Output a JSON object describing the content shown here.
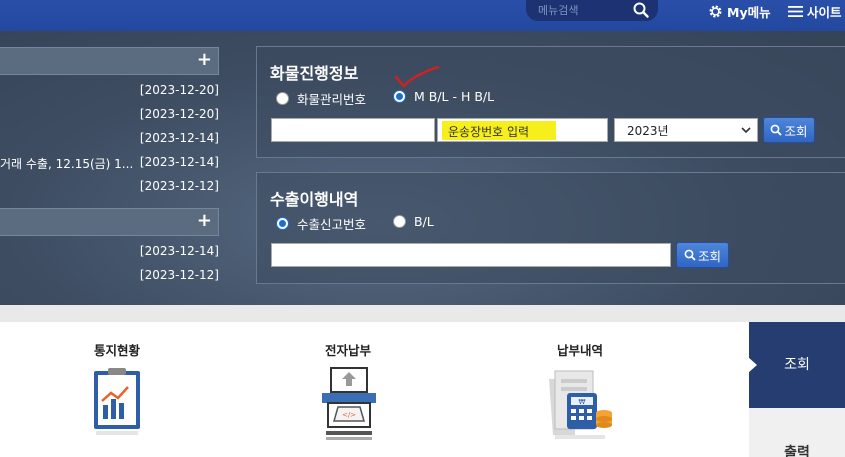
{
  "topbar": {
    "menu_search_placeholder": "메뉴검색",
    "my_menu_label": "My메뉴",
    "sitemap_label": "사이트"
  },
  "notices": {
    "group1": {
      "rows": [
        {
          "title": "",
          "date": "[2023-12-20]"
        },
        {
          "title": "",
          "date": "[2023-12-20]"
        },
        {
          "title": "",
          "date": "[2023-12-14]"
        },
        {
          "title": "거래 수출, 12.15(금) 1...",
          "date": "[2023-12-14]"
        },
        {
          "title": "",
          "date": "[2023-12-12]"
        }
      ]
    },
    "group2": {
      "rows": [
        {
          "title": "",
          "date": "[2023-12-14]"
        },
        {
          "title": "",
          "date": "[2023-12-12]"
        }
      ]
    },
    "more_label": "+"
  },
  "cargo": {
    "title": "화물진행정보",
    "radio1": "화물관리번호",
    "radio2": "M B/L - H B/L",
    "selected": "radio2",
    "input1_value": "",
    "input2_placeholder": "운송장번호 입력",
    "year_value": "2023년",
    "search_label": "조회"
  },
  "export": {
    "title": "수출이행내역",
    "radio1": "수출신고번호",
    "radio2": "B/L",
    "selected": "radio1",
    "input_value": "",
    "search_label": "조회"
  },
  "services": [
    {
      "label": "통지현황",
      "icon": "report-chart-icon"
    },
    {
      "label": "전자납부",
      "icon": "electronic-payment-icon"
    },
    {
      "label": "납부내역",
      "icon": "payment-history-icon"
    }
  ],
  "side_tabs": {
    "active": "조회",
    "next": "출력"
  },
  "colors": {
    "brand_blue": "#2a4fa8",
    "button_blue": "#3a72d0",
    "highlight_yellow": "#f7ef1c",
    "annotation_red": "#d42020"
  }
}
